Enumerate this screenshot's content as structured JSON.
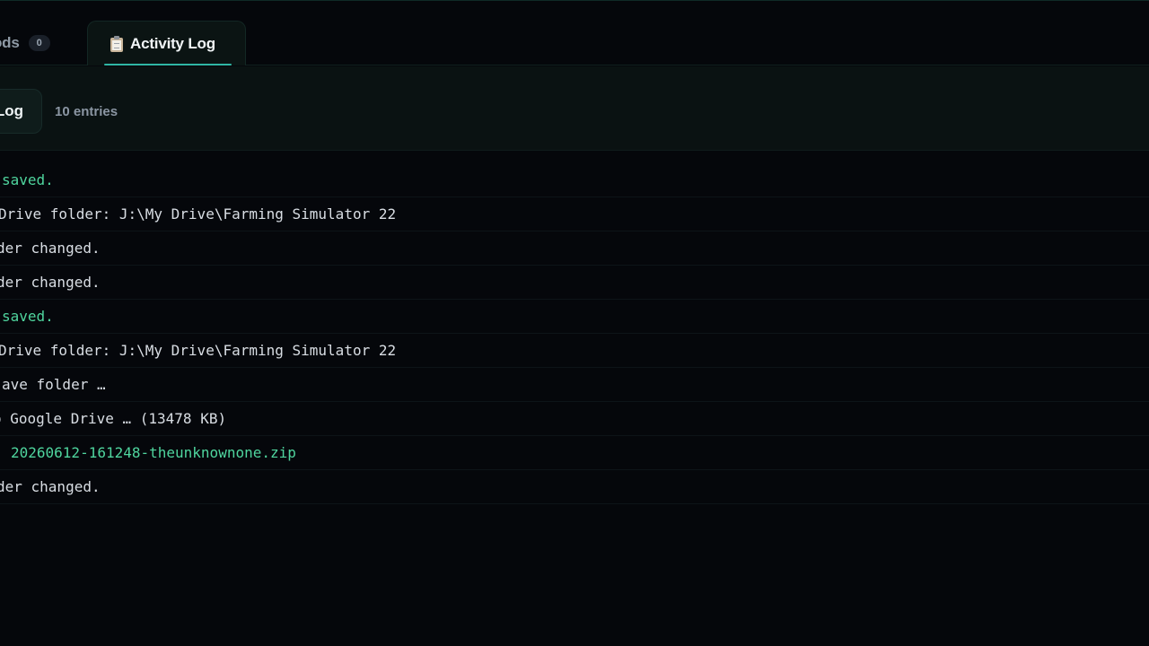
{
  "tabs": {
    "mods": {
      "label": "Mods",
      "count": "0"
    },
    "activity": {
      "label": "Activity Log"
    }
  },
  "panel": {
    "title": "Log",
    "entries": "10 entries"
  },
  "colors": {
    "accent": "#2fb6a4",
    "success_text": "#4fd59e",
    "background": "#05070b"
  },
  "log": {
    "rows": [
      {
        "text": "saved.",
        "status": "success"
      },
      {
        "text": "Drive folder: J:\\My Drive\\Farming Simulator 22",
        "status": "normal"
      },
      {
        "text": "der changed.",
        "status": "normal"
      },
      {
        "text": "der changed.",
        "status": "normal"
      },
      {
        "text": "saved.",
        "status": "success"
      },
      {
        "text": "Drive folder: J:\\My Drive\\Farming Simulator 22",
        "status": "normal"
      },
      {
        "text": "ave folder …",
        "status": "normal"
      },
      {
        "text": "o Google Drive … (13478 KB)",
        "status": "normal"
      },
      {
        "text": "20260612-161248-theunknownone.zip",
        "status": "success"
      },
      {
        "text": "der changed.",
        "status": "normal"
      }
    ]
  }
}
